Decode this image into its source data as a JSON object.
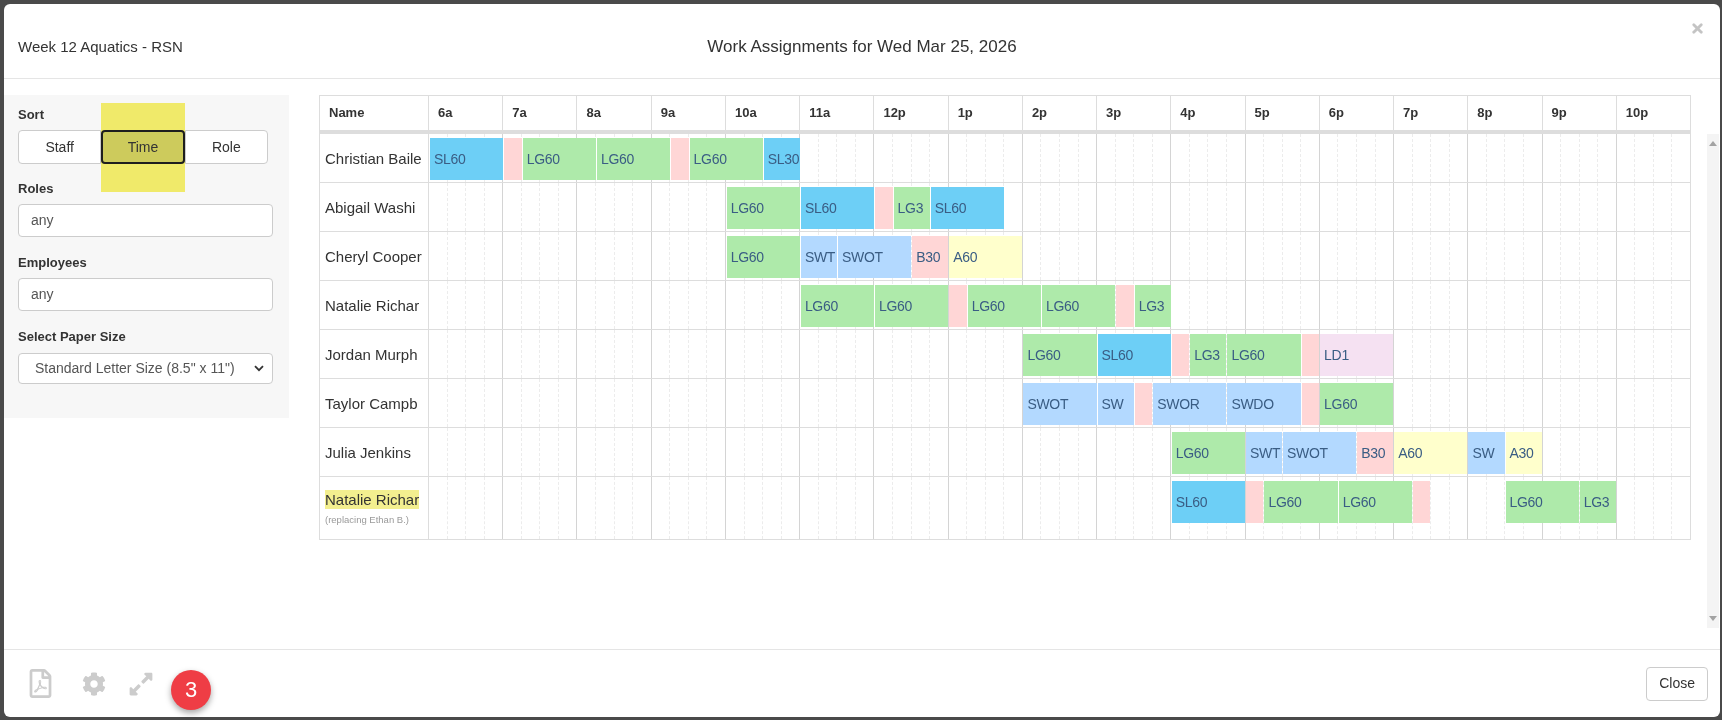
{
  "modal": {
    "schedule_name": "Week 12 Aquatics - RSN",
    "title": "Work Assignments for Wed Mar 25, 2026"
  },
  "filters": {
    "sort": {
      "label": "Sort",
      "options": [
        {
          "label": "Staff",
          "selected": false,
          "highlighted": false
        },
        {
          "label": "Time",
          "selected": true,
          "highlighted": true
        },
        {
          "label": "Role",
          "selected": false,
          "highlighted": false
        }
      ]
    },
    "roles": {
      "label": "Roles",
      "value": "any"
    },
    "employees": {
      "label": "Employees",
      "value": "any"
    },
    "paper_size": {
      "label": "Select Paper Size",
      "value": "Standard Letter Size (8.5\" x 11\")"
    }
  },
  "schedule": {
    "name_header": "Name",
    "hours": [
      "6a",
      "7a",
      "8a",
      "9a",
      "10a",
      "11a",
      "12p",
      "1p",
      "2p",
      "3p",
      "4p",
      "5p",
      "6p",
      "7p",
      "8p",
      "9p",
      "10p"
    ],
    "rows": [
      {
        "name": "Christian Baile",
        "highlighted": false,
        "segments": [
          {
            "kind": "hour",
            "label": "SL60",
            "color": "#6dcff6"
          },
          {
            "kind": "quarter",
            "color": "#ffd6d6"
          },
          {
            "kind": "hour",
            "label": "LG60",
            "color": "#aeeaaa"
          },
          {
            "kind": "hour",
            "label": "LG60",
            "color": "#aeeaaa"
          },
          {
            "kind": "quarter",
            "color": "#ffd6d6"
          },
          {
            "kind": "hour",
            "label": "LG60",
            "color": "#aeeaaa"
          },
          {
            "kind": "half",
            "label": "SL30",
            "color": "#6dcff6"
          }
        ]
      },
      {
        "name": "Abigail Washi",
        "highlighted": false,
        "segments": [
          {
            "kind": "gap"
          },
          {
            "kind": "gap"
          },
          {
            "kind": "gap"
          },
          {
            "kind": "gap"
          },
          {
            "kind": "hour",
            "label": "LG60",
            "color": "#aeeaaa"
          },
          {
            "kind": "hour",
            "label": "SL60",
            "color": "#6dcff6"
          },
          {
            "kind": "quarter",
            "color": "#ffd6d6"
          },
          {
            "kind": "half",
            "label": "LG3",
            "color": "#aeeaaa"
          },
          {
            "kind": "hour",
            "label": "SL60",
            "color": "#6dcff6"
          }
        ]
      },
      {
        "name": "Cheryl Cooper",
        "highlighted": false,
        "segments": [
          {
            "kind": "gap"
          },
          {
            "kind": "gap"
          },
          {
            "kind": "gap"
          },
          {
            "kind": "gap"
          },
          {
            "kind": "hour",
            "label": "LG60",
            "color": "#aeeaaa"
          },
          {
            "kind": "half",
            "label": "SWT",
            "color": "#b3d9ff"
          },
          {
            "kind": "hour",
            "label": "SWOT",
            "color": "#b3d9ff"
          },
          {
            "kind": "half",
            "label": "B30",
            "color": "#ffd6d6"
          },
          {
            "kind": "hour",
            "label": "A60",
            "color": "#ffffcc"
          }
        ]
      },
      {
        "name": "Natalie Richar",
        "highlighted": false,
        "segments": [
          {
            "kind": "gap"
          },
          {
            "kind": "gap"
          },
          {
            "kind": "gap"
          },
          {
            "kind": "gap"
          },
          {
            "kind": "gap"
          },
          {
            "kind": "hour",
            "label": "LG60",
            "color": "#aeeaaa"
          },
          {
            "kind": "hour",
            "label": "LG60",
            "color": "#aeeaaa"
          },
          {
            "kind": "quarter",
            "color": "#ffd6d6"
          },
          {
            "kind": "hour",
            "label": "LG60",
            "color": "#aeeaaa"
          },
          {
            "kind": "hour",
            "label": "LG60",
            "color": "#aeeaaa"
          },
          {
            "kind": "quarter",
            "color": "#ffd6d6"
          },
          {
            "kind": "half",
            "label": "LG3",
            "color": "#aeeaaa"
          }
        ]
      },
      {
        "name": "Jordan Murph",
        "highlighted": false,
        "segments": [
          {
            "kind": "gap"
          },
          {
            "kind": "gap"
          },
          {
            "kind": "gap"
          },
          {
            "kind": "gap"
          },
          {
            "kind": "gap"
          },
          {
            "kind": "gap"
          },
          {
            "kind": "gap"
          },
          {
            "kind": "gap"
          },
          {
            "kind": "hour",
            "label": "LG60",
            "color": "#aeeaaa"
          },
          {
            "kind": "hour",
            "label": "SL60",
            "color": "#6dcff6"
          },
          {
            "kind": "quarter",
            "color": "#ffd6d6"
          },
          {
            "kind": "half",
            "label": "LG3",
            "color": "#aeeaaa"
          },
          {
            "kind": "hour",
            "label": "LG60",
            "color": "#aeeaaa"
          },
          {
            "kind": "quarter",
            "color": "#ffd6d6"
          },
          {
            "kind": "hour",
            "label": "LD1",
            "color": "#f5e1f2"
          }
        ]
      },
      {
        "name": "Taylor Campb",
        "highlighted": false,
        "segments": [
          {
            "kind": "gap"
          },
          {
            "kind": "gap"
          },
          {
            "kind": "gap"
          },
          {
            "kind": "gap"
          },
          {
            "kind": "gap"
          },
          {
            "kind": "gap"
          },
          {
            "kind": "gap"
          },
          {
            "kind": "gap"
          },
          {
            "kind": "hour",
            "label": "SWOT",
            "color": "#b3d9ff"
          },
          {
            "kind": "half",
            "label": "SW",
            "color": "#b3d9ff"
          },
          {
            "kind": "quarter",
            "color": "#ffd6d6"
          },
          {
            "kind": "hour",
            "label": "SWOR",
            "color": "#b3d9ff"
          },
          {
            "kind": "hour",
            "label": "SWDO",
            "color": "#b3d9ff"
          },
          {
            "kind": "quarter",
            "color": "#ffd6d6"
          },
          {
            "kind": "hour",
            "label": "LG60",
            "color": "#aeeaaa"
          }
        ]
      },
      {
        "name": "Julia Jenkins",
        "highlighted": false,
        "segments": [
          {
            "kind": "gap"
          },
          {
            "kind": "gap"
          },
          {
            "kind": "gap"
          },
          {
            "kind": "gap"
          },
          {
            "kind": "gap"
          },
          {
            "kind": "gap"
          },
          {
            "kind": "gap"
          },
          {
            "kind": "gap"
          },
          {
            "kind": "gap"
          },
          {
            "kind": "gap"
          },
          {
            "kind": "hour",
            "label": "LG60",
            "color": "#aeeaaa"
          },
          {
            "kind": "half",
            "label": "SWT",
            "color": "#b3d9ff"
          },
          {
            "kind": "hour",
            "label": "SWOT",
            "color": "#b3d9ff"
          },
          {
            "kind": "half",
            "label": "B30",
            "color": "#ffd6d6"
          },
          {
            "kind": "hour",
            "label": "A60",
            "color": "#ffffcc"
          },
          {
            "kind": "half",
            "label": "SW",
            "color": "#b3d9ff"
          },
          {
            "kind": "half",
            "label": "A30",
            "color": "#ffffcc"
          }
        ]
      },
      {
        "name": "Natalie Richar",
        "highlighted": true,
        "note": "(replacing Ethan B.)",
        "segments": [
          {
            "kind": "gap"
          },
          {
            "kind": "gap"
          },
          {
            "kind": "gap"
          },
          {
            "kind": "gap"
          },
          {
            "kind": "gap"
          },
          {
            "kind": "gap"
          },
          {
            "kind": "gap"
          },
          {
            "kind": "gap"
          },
          {
            "kind": "gap"
          },
          {
            "kind": "gap"
          },
          {
            "kind": "hour",
            "label": "SL60",
            "color": "#6dcff6"
          },
          {
            "kind": "quarter",
            "color": "#ffd6d6"
          },
          {
            "kind": "hour",
            "label": "LG60",
            "color": "#aeeaaa"
          },
          {
            "kind": "hour",
            "label": "LG60",
            "color": "#aeeaaa"
          },
          {
            "kind": "quarter",
            "color": "#ffd6d6"
          },
          {
            "kind": "gap"
          },
          {
            "kind": "hour",
            "label": "LG60",
            "color": "#aeeaaa"
          },
          {
            "kind": "half",
            "label": "LG3",
            "color": "#aeeaaa"
          }
        ]
      }
    ]
  },
  "footer": {
    "badge": "3",
    "close": "Close"
  }
}
